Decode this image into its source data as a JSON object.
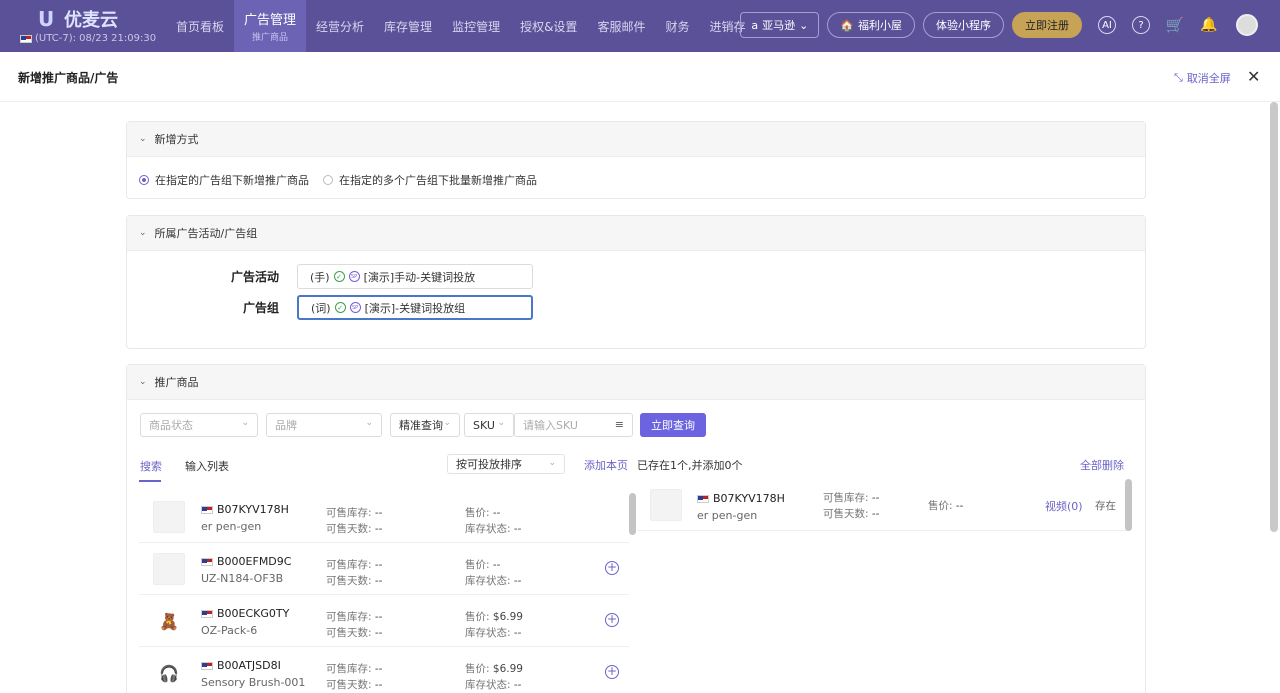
{
  "app": {
    "logo_text": "优麦云",
    "timezone": "(UTC-7): 08/23 21:09:30"
  },
  "nav": [
    {
      "label": "首页看板"
    },
    {
      "label": "广告管理",
      "sub": "推广商品"
    },
    {
      "label": "经营分析"
    },
    {
      "label": "库存管理"
    },
    {
      "label": "监控管理"
    },
    {
      "label": "授权&设置"
    },
    {
      "label": "客服邮件"
    },
    {
      "label": "财务"
    },
    {
      "label": "进销存"
    }
  ],
  "top_right": {
    "marketplace": "亚马逊",
    "welfare": "福利小屋",
    "mini_program": "体验小程序",
    "register": "立即注册"
  },
  "page": {
    "title": "新增推广商品/广告",
    "exit_fullscreen": "取消全屏"
  },
  "section_mode": {
    "title": "新增方式",
    "options": [
      "在指定的广告组下新增推广商品",
      "在指定的多个广告组下批量新增推广商品"
    ],
    "selected": 0
  },
  "section_group": {
    "title": "所属广告活动/广告组",
    "campaign_label": "广告活动",
    "campaign_prefix": "(手)",
    "campaign_value": "[演示]手动-关键词投放",
    "group_label": "广告组",
    "group_prefix": "(词)",
    "group_value": "[演示]-关键词投放组"
  },
  "section_products": {
    "title": "推广商品",
    "filters": {
      "status_placeholder": "商品状态",
      "brand_placeholder": "品牌",
      "match_mode": "精准查询",
      "field": "SKU",
      "sku_placeholder": "请输入SKU",
      "query_button": "立即查询"
    },
    "tabs": [
      "搜索",
      "输入列表"
    ],
    "sort": "按可投放排序",
    "add_page": "添加本页",
    "summary": "已存在1个,并添加0个",
    "delete_all": "全部删除",
    "labels": {
      "stock": "可售库存:",
      "days": "可售天数:",
      "price": "售价:",
      "inv_status": "库存状态:"
    },
    "items": [
      {
        "asin": "B07KYV178H",
        "sku": "er pen-gen",
        "stock": "--",
        "days": "--",
        "price": "--",
        "inv_status": "--",
        "thumb": ""
      },
      {
        "asin": "B000EFMD9C",
        "sku": "UZ-N184-OF3B",
        "stock": "--",
        "days": "--",
        "price": "--",
        "inv_status": "--",
        "thumb": ""
      },
      {
        "asin": "B00ECKG0TY",
        "sku": "OZ-Pack-6",
        "stock": "--",
        "days": "--",
        "price": "$6.99",
        "inv_status": "--",
        "thumb": "🧸"
      },
      {
        "asin": "B00ATJSD8I",
        "sku": "Sensory Brush-001",
        "stock": "--",
        "days": "--",
        "price": "$6.99",
        "inv_status": "--",
        "thumb": "🎧"
      }
    ],
    "added": {
      "asin": "B07KYV178H",
      "sku": "er pen-gen",
      "stock": "--",
      "days": "--",
      "price": "--",
      "video": "视频(0)",
      "state": "存在"
    }
  }
}
